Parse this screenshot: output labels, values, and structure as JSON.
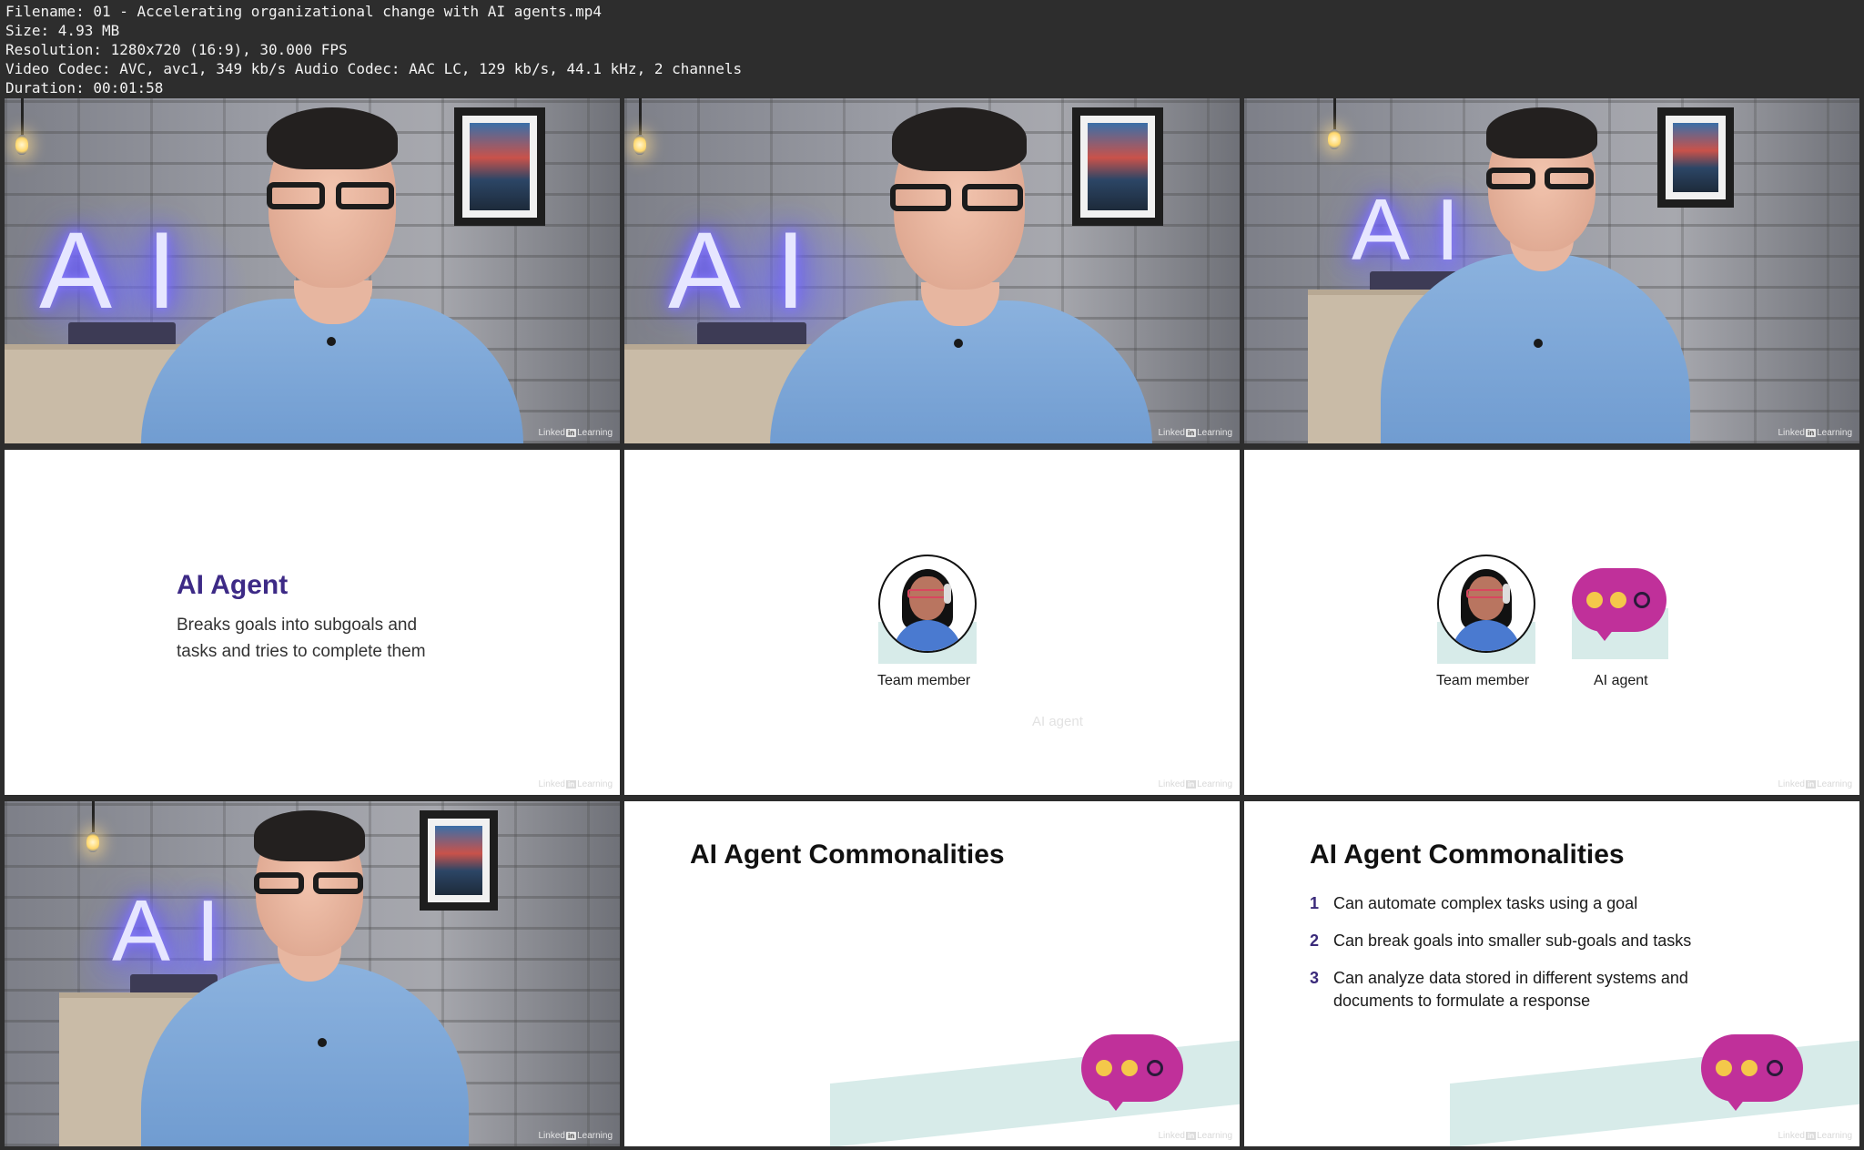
{
  "header": {
    "filename": "Filename: 01 - Accelerating organizational change with AI agents.mp4",
    "size": "Size: 4.93 MB",
    "resolution": "Resolution: 1280x720 (16:9), 30.000 FPS",
    "codec": "Video Codec: AVC, avc1, 349 kb/s Audio Codec: AAC LC, 129 kb/s, 44.1 kHz, 2 channels",
    "duration": "Duration: 00:01:58"
  },
  "watermark": {
    "brand_left": "Linked",
    "brand_in": "in",
    "brand_right": "Learning"
  },
  "video": {
    "neon_text": "AI"
  },
  "slide_ai_agent": {
    "title": "AI Agent",
    "body_line1": "Breaks goals into subgoals and",
    "body_line2": "tasks and tries to complete them"
  },
  "slide_team": {
    "team_label": "Team member",
    "ghost_label": "AI agent"
  },
  "slide_team_agent": {
    "team_label": "Team member",
    "agent_label": "AI agent"
  },
  "slide_commonalities": {
    "title": "AI Agent Commonalities",
    "items": [
      {
        "num": "1",
        "text": "Can automate complex tasks using a goal"
      },
      {
        "num": "2",
        "text": "Can break goals into smaller sub-goals and tasks"
      },
      {
        "num": "3",
        "text": "Can analyze data stored in different systems and documents to formulate a response"
      }
    ]
  },
  "colors": {
    "title_purple": "#3d2a86",
    "bubble_magenta": "#c0309a",
    "dot_yellow": "#f4c84a",
    "accent_mint": "#d7ebe9"
  }
}
